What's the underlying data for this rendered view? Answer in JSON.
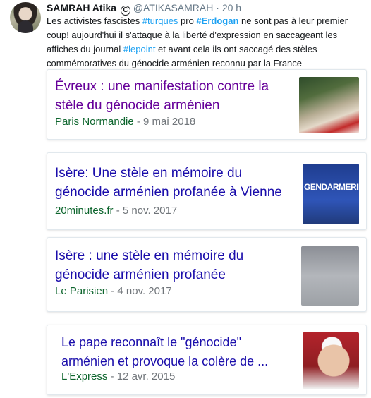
{
  "tweet": {
    "name": "SAMRAH Atika",
    "verified_glyph": "C",
    "handle": "@ATIKASAMRAH",
    "separator": "·",
    "time": "20 h",
    "text_parts": {
      "p1": "Les activistes fascistes ",
      "tag1": "#turques",
      "p2": " pro ",
      "tag2": "#Erdogan",
      "p3": " ne sont pas à leur premier coup! aujourd'hui il s'attaque à la liberté d'expression en saccageant les affiches du journal ",
      "tag3": "#lepoint",
      "p4": " et avant cela ils ont saccagé des stèles commémoratives du génocide  arménien reconnu par la France"
    }
  },
  "cards": [
    {
      "title": "Évreux : une manifestation contre la stèle du génocide arménien",
      "source": "Paris Normandie",
      "date": " - 9 mai 2018",
      "thumb_icon": "memorial-photo"
    },
    {
      "title": "Isère: Une stèle en mémoire du génocide arménien profanée à Vienne",
      "source": "20minutes.fr",
      "date": " - 5 nov. 2017",
      "thumb_icon": "gendarmerie-van-photo",
      "thumb_text": "GENDARMERIE"
    },
    {
      "title": "Isère : une stèle en mémoire du génocide arménien profanée",
      "source": "Le Parisien",
      "date": " - 4 nov. 2017",
      "thumb_icon": "defaced-stele-photo"
    },
    {
      "title": "Le pape reconnaît le \"génocide\" arménien et provoque la colère de ...",
      "source": "L'Express",
      "date": " - 12 avr. 2015",
      "thumb_icon": "pope-portrait-photo"
    }
  ],
  "colors": {
    "link_blue": "#1a0dab",
    "visited_purple": "#660099",
    "source_green": "#0d652d",
    "hashtag_blue": "#1da1f2"
  }
}
